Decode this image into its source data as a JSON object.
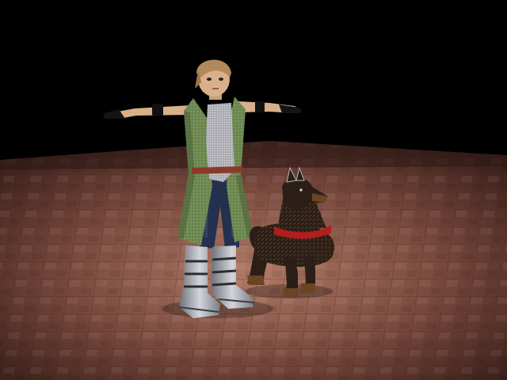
{
  "scene": {
    "description_visible_text": "",
    "colors": {
      "background": "#000000",
      "floor_base": "#7a4a3e",
      "floor_light": "#a06a5a",
      "floor_dark": "#4e2c24",
      "coat": "#6f8a52",
      "coat_dark": "#4c6338",
      "skin": "#d8b08a",
      "hair": "#b08a5c",
      "pants": "#23314e",
      "armor": "#b8bcc4",
      "belt": "#8a3a2a",
      "dog_body": "#2a1e16",
      "dog_fur": "#5a3a1e",
      "dog_collar": "#b01e1e"
    },
    "objects": [
      {
        "name": "character-figure"
      },
      {
        "name": "dog-figure"
      },
      {
        "name": "tiled-floor"
      }
    ]
  }
}
